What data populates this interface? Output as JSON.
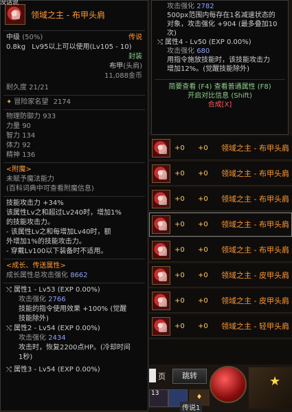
{
  "corner_text": "没话说",
  "left_tooltip": {
    "item_title": "领域之主 - 布甲头肩",
    "grade": "中级",
    "grade_pct": "(50%)",
    "rarity": "传说",
    "weight": "0.8kg",
    "level_req": "Lv95以上可以使用(Lv105 - 10)",
    "sealed": "封装",
    "type": "布甲",
    "slot": "(头肩)",
    "price": "11,088金币",
    "durability": "耐久度 21/21",
    "adventure_fame_label": "冒险家名望",
    "adventure_fame_value": "2174",
    "stats": [
      {
        "label": "物理防御力",
        "value": "933"
      },
      {
        "label": "力量",
        "value": "90"
      },
      {
        "label": "智力",
        "value": "134"
      },
      {
        "label": "体力",
        "value": "92"
      },
      {
        "label": "精神",
        "value": "136"
      }
    ],
    "enchant_header": "<附魔>",
    "enchant_lines": [
      "未赋予魔法能力",
      "(百科词典中可查看附魔信息)"
    ],
    "skill_lines": [
      "技能攻击力 +34%",
      "该属性Lv之和超过Lv240时，增加1%",
      "的技能攻击力。",
      "- 该属性Lv之和每增加Lv40时，额",
      "外增加1%的技能攻击力。",
      "- 穿戴Lv100以下装备时不适用。"
    ],
    "growth_header": "<成长、传送属性>",
    "growth_total_label": "成长属性总攻击强化",
    "growth_total_value": "8662",
    "attr1": {
      "label": "属性1 - Lv53 (EXP 0.00%)",
      "atk_label": "攻击强化",
      "atk_value": "2766",
      "desc": [
        "技能的指令使用效果 +100% (觉醒",
        "技能除外)"
      ]
    },
    "attr2": {
      "label": "属性2 - Lv54 (EXP 0.00%)",
      "atk_label": "攻击强化",
      "atk_value": "2434",
      "desc": [
        "攻击时，恢复2200点HP。(冷却时间",
        "1秒)"
      ]
    },
    "attr3": {
      "label": "属性3 - Lv54 (EXP 0.00%)"
    }
  },
  "right_tooltip": {
    "atk_label": "攻击强化",
    "atk_value": "2782",
    "desc1": [
      "500px范围内每存在1名减速状态的",
      "对象，攻击强化 +904 (最多叠加10",
      "次)"
    ],
    "attr4_label": "属性4 - Lv50 (EXP 0.00%)",
    "attr4_atk_label": "攻击强化",
    "attr4_atk_value": "680",
    "desc2": [
      "用指令施放技能时，该技能攻击力",
      "增加12%。(觉醒技能除外)"
    ],
    "footer1": "简要查看 (F4) 查看普通属性 (F8)",
    "footer2": "开启对比信息 (Shift)",
    "footer3": "合成[X]"
  },
  "items": [
    {
      "plus1": "+0",
      "plus2": "+0",
      "name": "领域之主 - 布甲头肩"
    },
    {
      "plus1": "+0",
      "plus2": "+0",
      "name": "领域之主 - 布甲头肩"
    },
    {
      "plus1": "+0",
      "plus2": "+0",
      "name": "领域之主 - 布甲头肩"
    },
    {
      "plus1": "+0",
      "plus2": "+0",
      "name": "领域之主 - 布甲头肩"
    },
    {
      "plus1": "+0",
      "plus2": "+0",
      "name": "领域之主 - 布甲头肩"
    },
    {
      "plus1": "+0",
      "plus2": "+0",
      "name": "领域之主 - 皮甲头肩"
    },
    {
      "plus1": "+0",
      "plus2": "+0",
      "name": "领域之主 - 皮甲头肩"
    },
    {
      "plus1": "+0",
      "plus2": "+0",
      "name": "领域之主 - 轻甲头肩"
    }
  ],
  "bottom": {
    "page_label": "页",
    "jump_button": "跳转",
    "slot_number": "13",
    "chat_label": "传说1"
  }
}
